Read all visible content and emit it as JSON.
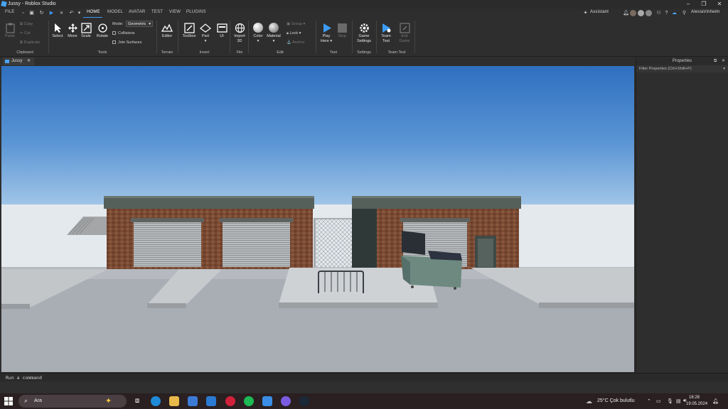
{
  "window": {
    "title": "Jussy - Roblox Studio"
  },
  "menu": {
    "file": "FILE",
    "tabs": [
      "HOME",
      "MODEL",
      "AVATAR",
      "TEST",
      "VIEW",
      "PLUGINS"
    ],
    "assistant": "Assistant",
    "username": "AlesiaVinheim"
  },
  "ribbon": {
    "clipboard": {
      "paste": "Paste",
      "copy": "Copy",
      "cut": "Cut",
      "duplicate": "Duplicate",
      "label": "Clipboard"
    },
    "tools": {
      "select": "Select",
      "move": "Move",
      "scale": "Scale",
      "rotate": "Rotate",
      "mode_label": "Mode:",
      "mode_value": "Geometric",
      "collisions": "Collisions",
      "join": "Join Surfaces",
      "label": "Tools"
    },
    "terrain": {
      "editor": "Editor",
      "label": "Terrain"
    },
    "insert": {
      "toolbox": "Toolbox",
      "part": "Part",
      "ui": "UI",
      "label": "Insert"
    },
    "file": {
      "import": "Import",
      "import2": "3D",
      "label": "File"
    },
    "edit": {
      "color": "Color",
      "material": "Material",
      "group": "Group",
      "lock": "Lock",
      "anchor": "Anchor",
      "label": "Edit"
    },
    "test": {
      "play": "Play",
      "play2": "Here",
      "stop": "Stop",
      "label": "Test"
    },
    "settings": {
      "game": "Game",
      "game2": "Settings",
      "label": "Settings"
    },
    "teamtest": {
      "team": "Team",
      "team2": "Test",
      "exit": "Exit",
      "exit2": "Game",
      "label": "Team Test"
    }
  },
  "doc_tab": "Jussy",
  "properties": {
    "title": "Properties",
    "filter": "Filter Properties (Ctrl+Shift+P)"
  },
  "command_bar": {
    "placeholder": "Run a command"
  },
  "taskbar": {
    "search": "Ara",
    "weather": "25°C  Çok bulutlu",
    "time": "16:28",
    "date": "19.05.2024"
  }
}
